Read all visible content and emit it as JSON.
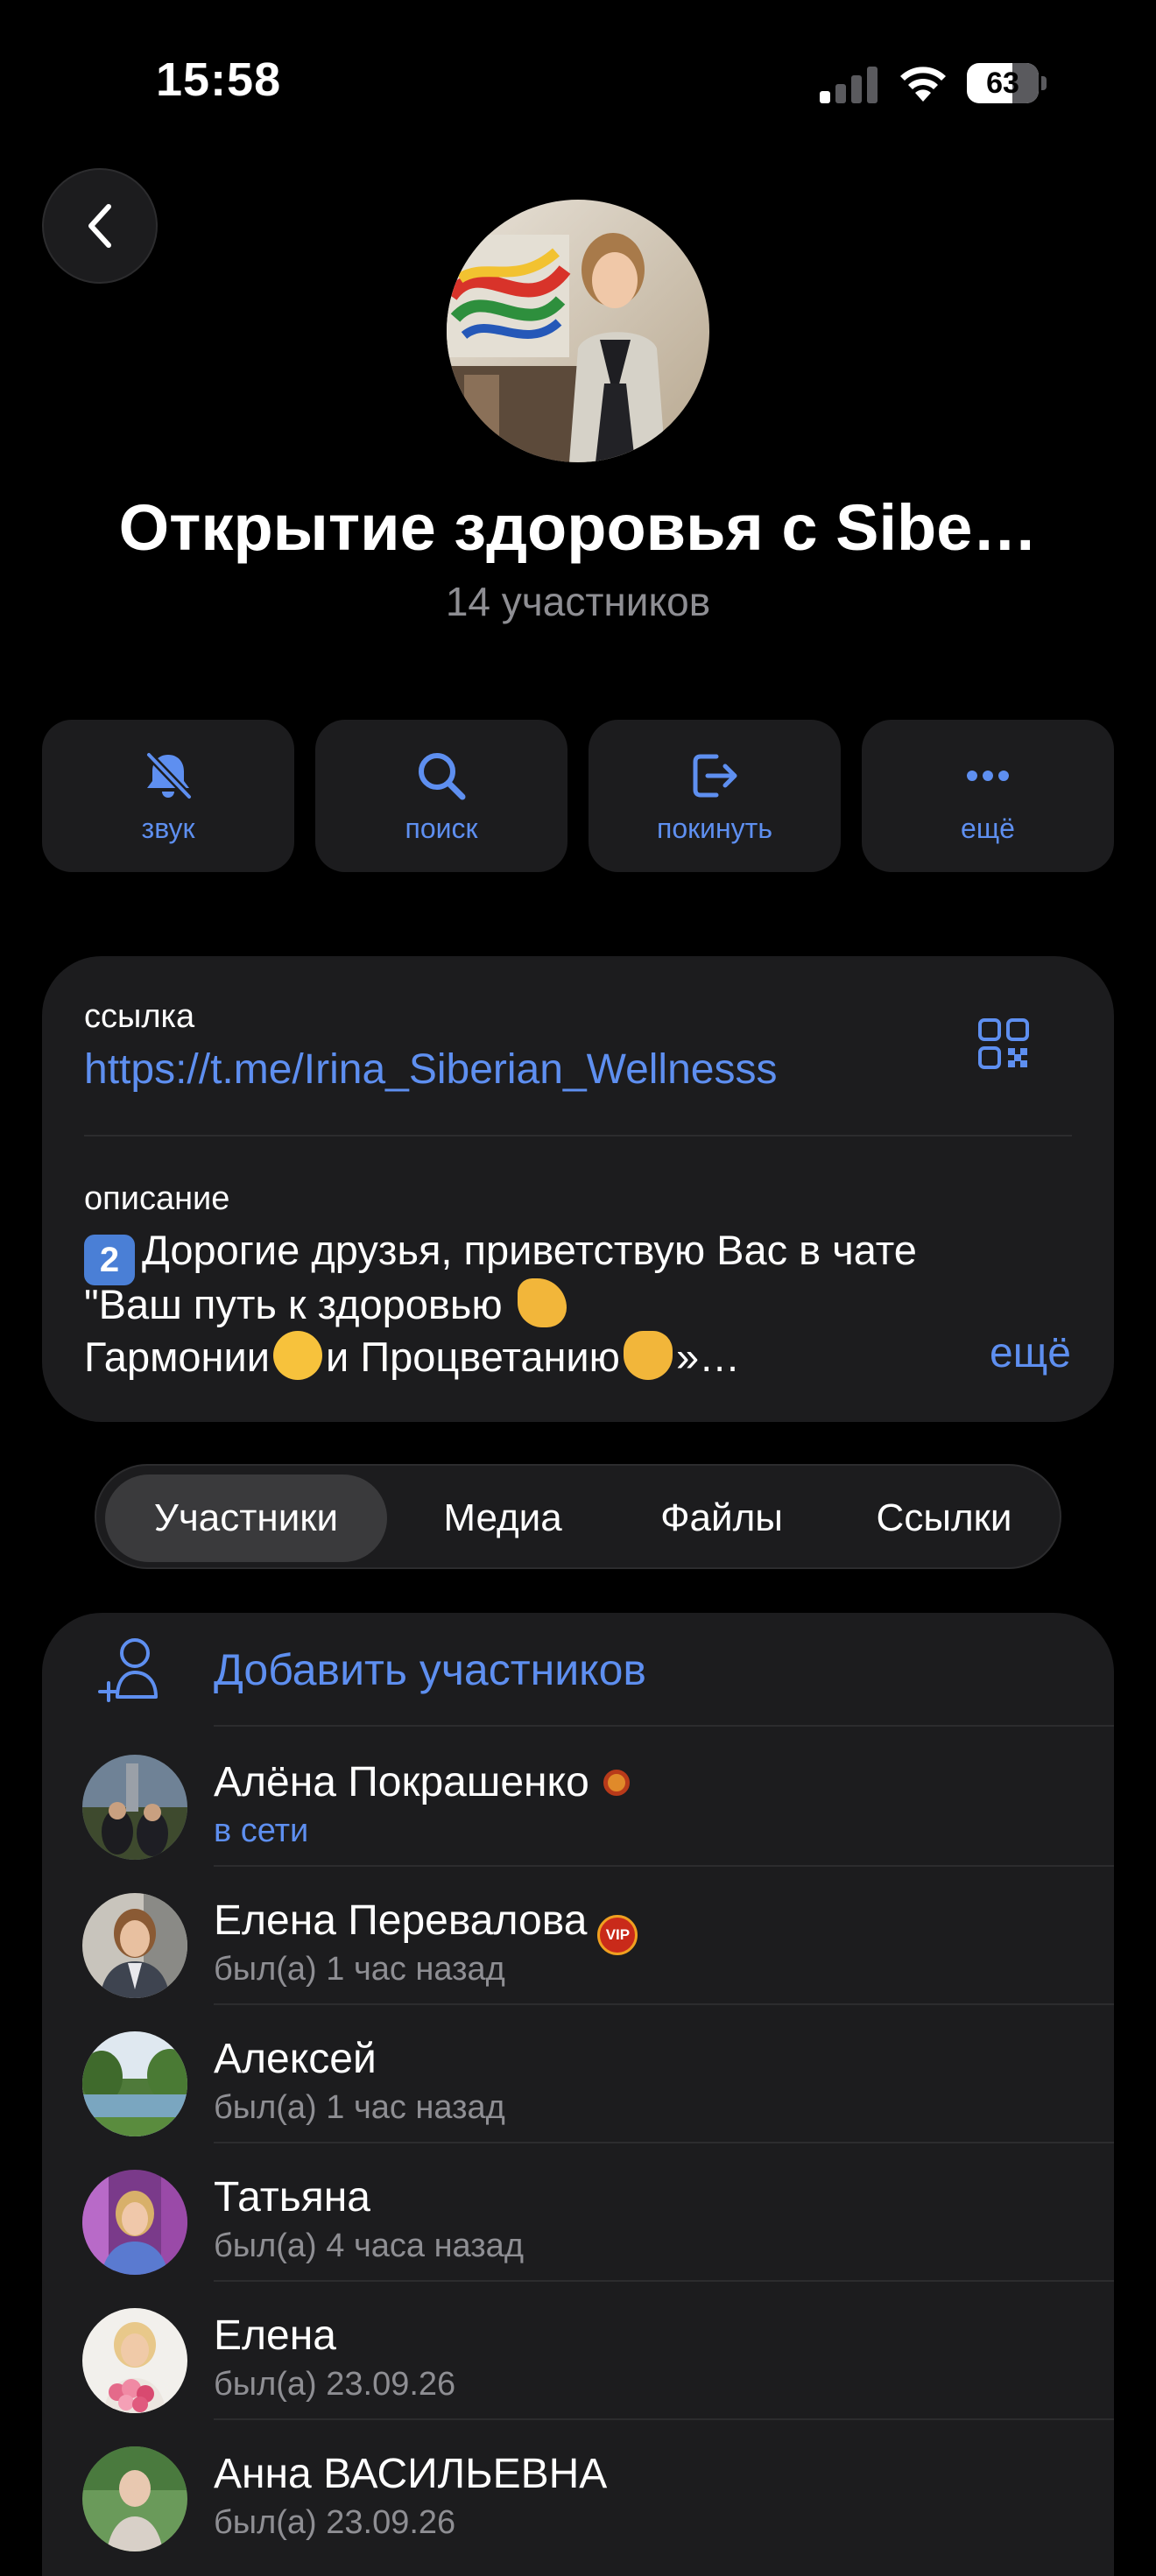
{
  "status_bar": {
    "time": "15:58",
    "battery_percent": "63",
    "battery_level": 0.63,
    "signal_bars_active": 1
  },
  "header": {
    "title": "Открытие здоровья с Sibe…",
    "subtitle": "14 участников"
  },
  "actions": [
    {
      "label": "звук",
      "icon": "bell-slash-icon"
    },
    {
      "label": "поиск",
      "icon": "search-icon"
    },
    {
      "label": "покинуть",
      "icon": "leave-icon"
    },
    {
      "label": "ещё",
      "icon": "more-icon"
    }
  ],
  "info": {
    "link_label": "ссылка",
    "link": "https://t.me/Irina_Siberian_Wellnesss",
    "description_label": "описание",
    "description_badge": "2",
    "description_line1": "Дорогие друзья, приветствую Вас в чате",
    "description_line2": "\"Ваш путь к здоровью",
    "description_line3a": "Гармонии",
    "description_line3b": "и Процветанию",
    "description_line3c": "»…",
    "more": "ещё"
  },
  "tabs": [
    "Участники",
    "Медиа",
    "Файлы",
    "Ссылки"
  ],
  "members_section": {
    "add_label": "Добавить участников",
    "members": [
      {
        "name": "Алёна Покрашенко",
        "status": "в сети",
        "online": true
      },
      {
        "name": "Елена Перевалова",
        "status": "был(а) 1 час назад",
        "online": false,
        "badge": "VIP"
      },
      {
        "name": "Алексей",
        "status": "был(а) 1 час назад",
        "online": false
      },
      {
        "name": "Татьяна",
        "status": "был(а) 4 часа назад",
        "online": false
      },
      {
        "name": "Елена",
        "status": "был(а) 23.09.26",
        "online": false
      },
      {
        "name": "Анна ВАСИЛЬЕВНА",
        "status": "был(а) 23.09.26",
        "online": false
      }
    ]
  },
  "colors": {
    "accent": "#5e8ff0",
    "background": "#000000",
    "card": "#1c1c1e",
    "secondary_text": "#8e8e93"
  }
}
